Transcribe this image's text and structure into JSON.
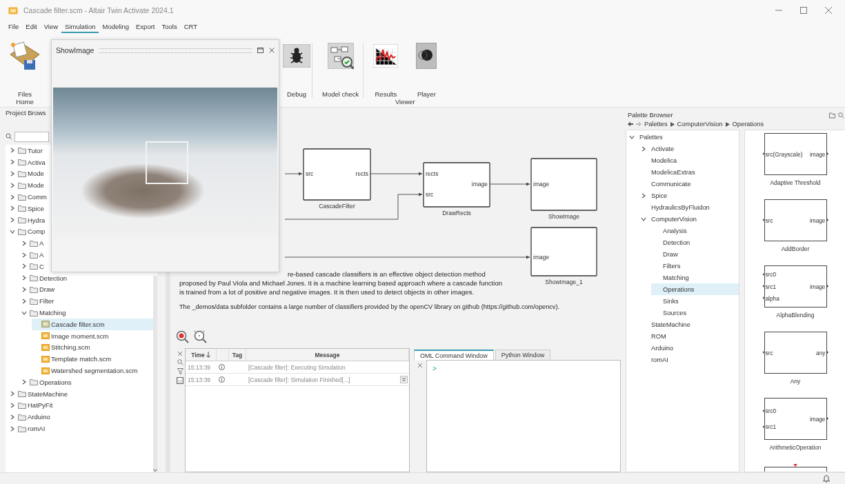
{
  "window": {
    "title": "Cascade filter.scm - Altair Twin Activate 2024.1"
  },
  "menu": [
    {
      "label": "File",
      "selected": false
    },
    {
      "label": "Edit",
      "selected": false
    },
    {
      "label": "View",
      "selected": false
    },
    {
      "label": "Simulation",
      "selected": true
    },
    {
      "label": "Modeling",
      "selected": false
    },
    {
      "label": "Export",
      "selected": false
    },
    {
      "label": "Tools",
      "selected": false
    },
    {
      "label": "CRT",
      "selected": false
    }
  ],
  "ribbon": {
    "groups": [
      {
        "label": "Home",
        "items": [
          {
            "kind": "files",
            "label": "Files"
          }
        ]
      },
      {
        "items": [
          {
            "kind": "debug",
            "label": "Debug"
          }
        ]
      },
      {
        "items": [
          {
            "kind": "model_check",
            "label": "Model check"
          }
        ]
      },
      {
        "label": "Viewer",
        "items": [
          {
            "kind": "results",
            "label": "Results"
          },
          {
            "kind": "player",
            "label": "Player"
          }
        ]
      }
    ]
  },
  "image_window": {
    "title": "ShowImage"
  },
  "project_browser": {
    "title": "Project Brows",
    "tree": [
      {
        "label": "Tutor",
        "kind": "folder",
        "expanded": false,
        "selected": false
      },
      {
        "label": "Activa",
        "kind": "folder",
        "expanded": false,
        "selected": false
      },
      {
        "label": "Mode",
        "kind": "folder",
        "expanded": false,
        "selected": false
      },
      {
        "label": "Mode",
        "kind": "folder",
        "expanded": false,
        "selected": false
      },
      {
        "label": "Comm",
        "kind": "folder",
        "expanded": false,
        "selected": false
      },
      {
        "label": "Spice",
        "kind": "folder",
        "expanded": false,
        "selected": false
      },
      {
        "label": "Hydra",
        "kind": "folder",
        "expanded": false,
        "selected": false
      },
      {
        "label": "Comp",
        "kind": "folder",
        "expanded": true,
        "selected": false,
        "children": [
          {
            "label": "A",
            "kind": "folder",
            "expanded": false,
            "selected": false
          },
          {
            "label": "A",
            "kind": "folder",
            "expanded": false,
            "selected": false
          },
          {
            "label": "C",
            "kind": "folder",
            "expanded": false,
            "selected": false
          },
          {
            "label": "Detection",
            "kind": "folder",
            "expanded": false,
            "selected": false
          },
          {
            "label": "Draw",
            "kind": "folder",
            "expanded": false,
            "selected": false
          },
          {
            "label": "Filter",
            "kind": "folder",
            "expanded": false,
            "selected": false
          },
          {
            "label": "Matching",
            "kind": "folder",
            "expanded": true,
            "selected": false,
            "children": [
              {
                "label": "Cascade filter.scm",
                "kind": "file",
                "selected": true
              },
              {
                "label": "Image moment.scm",
                "kind": "file",
                "selected": false
              },
              {
                "label": "Stitching.scm",
                "kind": "file",
                "selected": false
              },
              {
                "label": "Template match.scm",
                "kind": "file",
                "selected": false
              },
              {
                "label": "Watershed segmentation.scm",
                "kind": "file",
                "selected": false
              }
            ]
          },
          {
            "label": "Operations",
            "kind": "folder",
            "expanded": false,
            "selected": false
          }
        ]
      },
      {
        "label": "StateMachine",
        "kind": "folder",
        "expanded": false,
        "selected": false
      },
      {
        "label": "HatPyFit",
        "kind": "folder",
        "expanded": false,
        "selected": false
      },
      {
        "label": "Arduino",
        "kind": "folder",
        "expanded": false,
        "selected": false
      },
      {
        "label": "romAI",
        "kind": "folder",
        "expanded": false,
        "selected": false
      }
    ]
  },
  "diagram": {
    "blocks": [
      {
        "label": "CascadeFilter",
        "inputs": [
          "src"
        ],
        "outputs": [
          "rects"
        ]
      },
      {
        "label": "DrawRects",
        "inputs": [
          "rects",
          "src"
        ],
        "outputs": [
          "image"
        ]
      },
      {
        "label": "ShowImage",
        "inputs": [
          "image"
        ]
      },
      {
        "label": "ShowImage_1",
        "inputs": [
          "image"
        ]
      }
    ]
  },
  "description": {
    "lines": [
      "re-based cascade classifiers is an effective object detection method",
      "proposed by Paul Viola and Michael Jones. It is a machine learning based approach where a cascade function",
      "is trained from a lot of positive and negative images. It is then used to detect objects in other images."
    ],
    "note": "The _demos/data subfolder contains a large number of classifiers provided by the openCV library on github (https://github.com/opencv)."
  },
  "log": {
    "columns": [
      {
        "kind": "text",
        "label": "Time",
        "sorted": true
      },
      {
        "kind": "icon"
      },
      {
        "kind": "text",
        "label": "Tag"
      },
      {
        "kind": "text",
        "label": "Message"
      }
    ],
    "rows": [
      {
        "time": "15:13:39",
        "message": "[Cascade filter]: Executing Simulation",
        "expandable": false
      },
      {
        "time": "15:13:39",
        "message": "[Cascade filter]: Simulation Finished[...]",
        "expandable": true
      }
    ]
  },
  "console": {
    "tabs": [
      {
        "label": "OML Command Window",
        "selected": true
      },
      {
        "label": "Python Window",
        "selected": false
      }
    ],
    "prompt": ">"
  },
  "palette": {
    "title": "Palette Browser",
    "breadcrumb": [
      "Palettes",
      "ComputerVision",
      "Operations"
    ],
    "tree": [
      {
        "label": "Palettes",
        "expanded": true,
        "selected": false,
        "children": [
          {
            "label": "Activate",
            "expanded": false,
            "selected": false
          },
          {
            "label": "Modelica",
            "selected": false
          },
          {
            "label": "ModelicaExtras",
            "selected": false
          },
          {
            "label": "Communicate",
            "selected": false
          },
          {
            "label": "Spice",
            "expanded": false,
            "selected": false
          },
          {
            "label": "HydraulicsByFluidon",
            "selected": false
          },
          {
            "label": "ComputerVision",
            "expanded": true,
            "selected": false,
            "children": [
              {
                "label": "Analysis",
                "selected": false
              },
              {
                "label": "Detection",
                "selected": false
              },
              {
                "label": "Draw",
                "selected": false
              },
              {
                "label": "Filters",
                "selected": false
              },
              {
                "label": "Matching",
                "selected": false
              },
              {
                "label": "Operations",
                "selected": true
              },
              {
                "label": "Sinks",
                "selected": false
              },
              {
                "label": "Sources",
                "selected": false
              }
            ]
          },
          {
            "label": "StateMachine",
            "selected": false
          },
          {
            "label": "ROM",
            "selected": false
          },
          {
            "label": "Arduino",
            "selected": false
          },
          {
            "label": "romAI",
            "selected": false
          }
        ]
      }
    ],
    "blocks": [
      {
        "kind": "block",
        "label": "Adaptive Threshold",
        "inputs": [
          "src(Grayscale)"
        ],
        "outputs": [
          "image"
        ]
      },
      {
        "kind": "block",
        "label": "AddBorder",
        "inputs": [
          "src"
        ],
        "outputs": [
          "image"
        ]
      },
      {
        "kind": "block",
        "label": "AlphaBlending",
        "inputs": [
          "src0",
          "src1",
          "alpha"
        ],
        "outputs": [
          "image"
        ]
      },
      {
        "kind": "block",
        "label": "Any",
        "inputs": [
          "src"
        ],
        "outputs": [
          "any"
        ]
      },
      {
        "kind": "block",
        "label": "ArithmeticOperation",
        "inputs": [
          "src0",
          "src1"
        ],
        "outputs": [
          "image"
        ]
      },
      {
        "kind": "cut"
      }
    ]
  }
}
